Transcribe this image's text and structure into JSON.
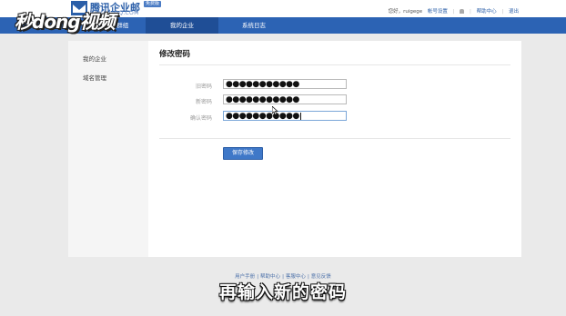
{
  "brand": {
    "name": "腾讯企业邮",
    "domain": "EXMAIL.QQ.COM",
    "edition": "免费版"
  },
  "watermark": "秒dong视频",
  "userbar": {
    "greeting": "您好，ruigege",
    "account_settings": "帐号设置",
    "help": "帮助中心",
    "logout": "退出",
    "sep": "|"
  },
  "nav": {
    "items": [
      {
        "label": "成员与群组"
      },
      {
        "label": "我的企业"
      },
      {
        "label": "系统日志"
      }
    ]
  },
  "sidebar": {
    "items": [
      {
        "label": "我的企业"
      },
      {
        "label": "域名管理"
      }
    ]
  },
  "main": {
    "title": "修改密码",
    "fields": [
      {
        "label": "旧密码",
        "value": "●●●●●●●●●●●"
      },
      {
        "label": "新密码",
        "value": "●●●●●●●●●●●"
      },
      {
        "label": "确认密码",
        "value": "●●●●●●●●●●●"
      }
    ],
    "save_label": "保存修改"
  },
  "footer": {
    "links": [
      "用户手册",
      "帮助中心",
      "客服中心",
      "意见反馈"
    ],
    "sep": "|"
  },
  "subtitle": "再输入新的密码",
  "colors": {
    "nav": "#2c63b4",
    "nav_active": "#1f4e96",
    "button": "#3f78c8"
  }
}
